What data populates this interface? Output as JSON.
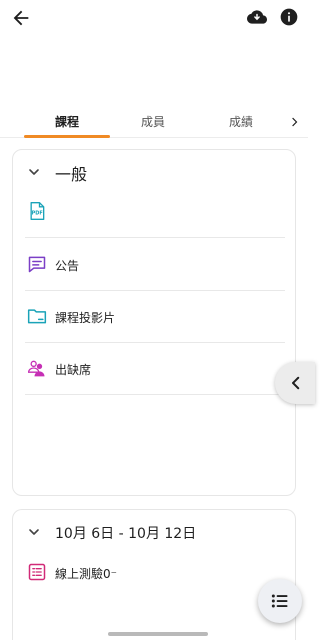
{
  "header": {
    "back_icon": "arrow-left-icon",
    "download_icon": "cloud-download-icon",
    "info_icon": "info-icon"
  },
  "tabs": [
    {
      "label": "課程",
      "active": true
    },
    {
      "label": "成員",
      "active": false
    },
    {
      "label": "成績",
      "active": false
    }
  ],
  "colors": {
    "accent": "#f08a24",
    "pdf": "#1aa3b8",
    "announcement": "#7b3fc6",
    "folder": "#1aa3b8",
    "attendance": "#c62fb5",
    "quiz": "#d12a78"
  },
  "sections": [
    {
      "title": "一般",
      "items": [
        {
          "label": "",
          "icon": "pdf-file-icon"
        },
        {
          "label": "公告",
          "icon": "announcement-icon"
        },
        {
          "label": "課程投影片",
          "icon": "folder-icon"
        },
        {
          "label": "出缺席",
          "icon": "attendance-icon"
        }
      ]
    },
    {
      "title": "10月 6日 - 10月 12日",
      "items": [
        {
          "label": "線上測驗0⁻",
          "icon": "quiz-icon"
        }
      ]
    }
  ],
  "side_tab_icon": "chevron-left-icon",
  "fab_icon": "list-icon"
}
